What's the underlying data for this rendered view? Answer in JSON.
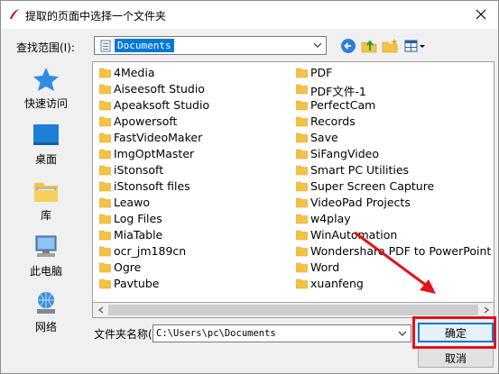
{
  "window": {
    "title": "提取的页面中选择一个文件夹"
  },
  "toolbar": {
    "lookin_label": "查找范围(I):",
    "current_path": "Documents"
  },
  "places": [
    {
      "label": "快速访问",
      "icon": "star-icon"
    },
    {
      "label": "桌面",
      "icon": "desktop-icon"
    },
    {
      "label": "库",
      "icon": "library-icon"
    },
    {
      "label": "此电脑",
      "icon": "computer-icon"
    },
    {
      "label": "网络",
      "icon": "network-icon"
    }
  ],
  "files_col1": [
    "4Media",
    "Aiseesoft Studio",
    "Apeaksoft Studio",
    "Apowersoft",
    "FastVideoMaker",
    "ImgOptMaster",
    "iStonsoft",
    "iStonsoft files",
    "Leawo",
    "Log Files",
    "MiaTable",
    "ocr_jm189cn",
    "Ogre",
    "Pavtube"
  ],
  "files_col2": [
    "PDF",
    "PDF文件-1",
    "PerfectCam",
    "Records",
    "Save",
    "SiFangVideo",
    "Smart PC Utilities",
    "Super Screen Capture",
    "VideoPad Projects",
    "w4play",
    "WinAutomation",
    "Wondershare PDF to PowerPoint",
    "Word",
    "xuanfeng"
  ],
  "bottom": {
    "name_label": "文件夹名称(N):",
    "name_value": "C:\\Users\\pc\\Documents",
    "ok_label": "确定",
    "cancel_label": "取消"
  },
  "colors": {
    "folder": "#f5c242",
    "selection": "#0078d7",
    "annotation": "#e0141b"
  }
}
